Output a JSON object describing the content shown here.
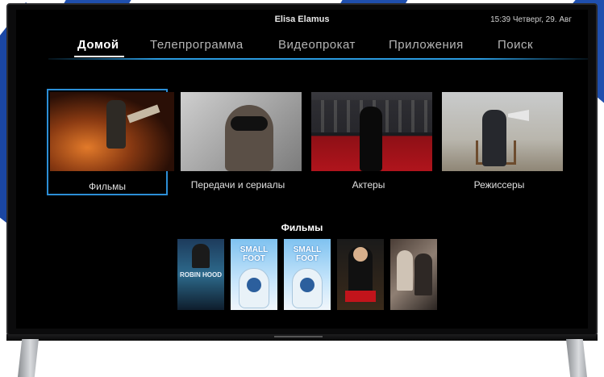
{
  "top_bar": {
    "user_name": "Elisa Elamus",
    "clock": "15:39 Четверг, 29. Авг"
  },
  "nav": {
    "items": [
      {
        "label": "Домой",
        "active": true
      },
      {
        "label": "Телепрограмма",
        "active": false
      },
      {
        "label": "Видеопрокат",
        "active": false
      },
      {
        "label": "Приложения",
        "active": false
      },
      {
        "label": "Поиск",
        "active": false
      }
    ]
  },
  "categories": [
    {
      "label": "Фильмы",
      "selected": true
    },
    {
      "label": "Передачи и сериалы",
      "selected": false
    },
    {
      "label": "Актеры",
      "selected": false
    },
    {
      "label": "Режиссеры",
      "selected": false
    }
  ],
  "section": {
    "title": "Фильмы",
    "posters": [
      {
        "title": "ROBIN HOOD"
      },
      {
        "title": "SMALL FOOT"
      },
      {
        "title": "SMALL FOOT"
      },
      {
        "title": ""
      },
      {
        "title": ""
      }
    ]
  },
  "colors": {
    "accent": "#2c8ed6",
    "background": "#000000",
    "brand_blue": "#1f4fae"
  }
}
